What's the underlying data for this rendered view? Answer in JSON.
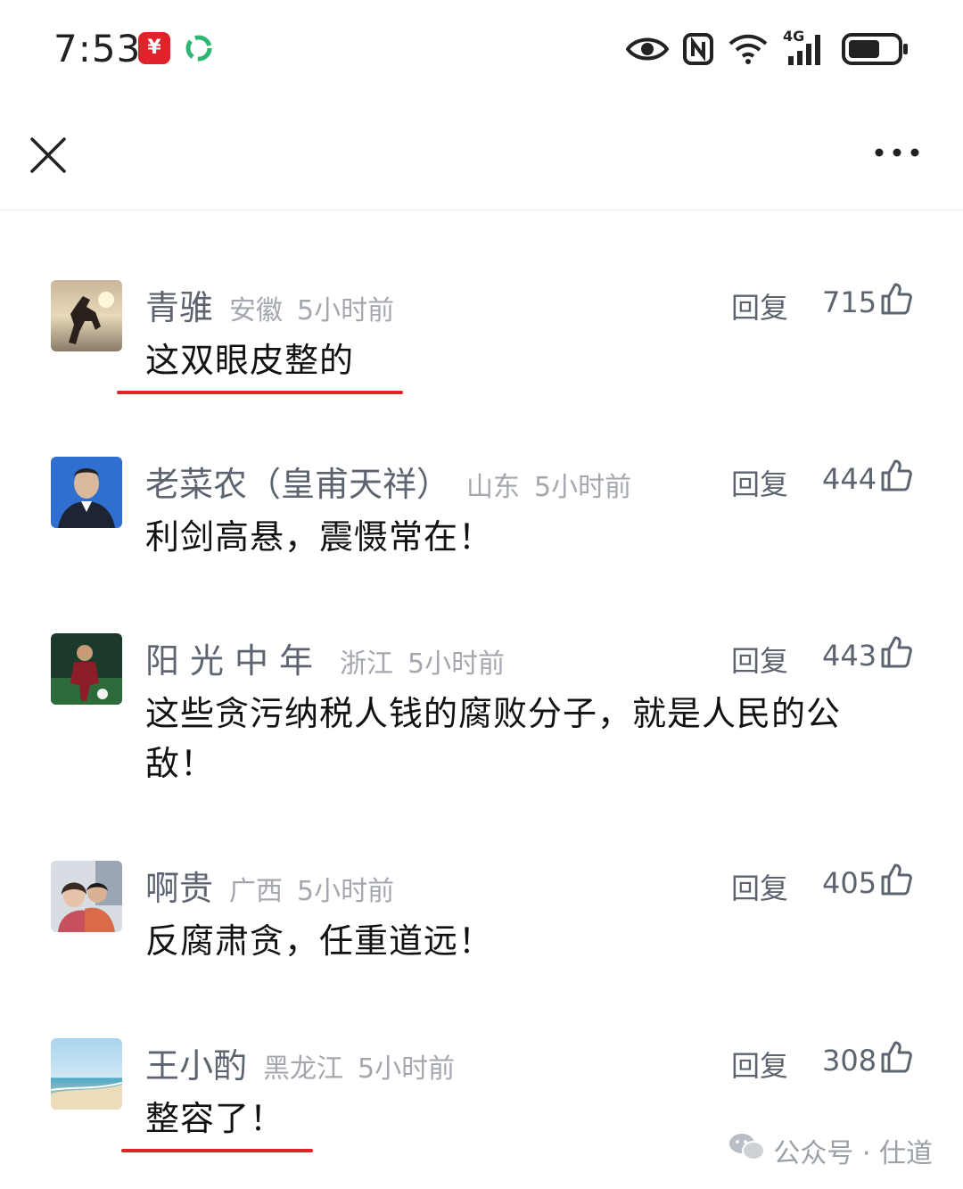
{
  "status_bar": {
    "time": "7:53",
    "app_icon_1": "bank-app-icon",
    "app_icon_2": "green-app-icon",
    "network_label": "4G",
    "icons": [
      "eye-icon",
      "nfc-icon",
      "wifi-icon",
      "cellular-signal-icon",
      "battery-icon"
    ]
  },
  "top_bar": {
    "close_icon": "close-icon",
    "more_icon": "more-icon"
  },
  "comments": [
    {
      "name": "青骓",
      "location": "安徽",
      "time": "5小时前",
      "reply": "回复",
      "likes": "715",
      "text": "这双眼皮整的",
      "underlined": true
    },
    {
      "name": "老菜农（皇甫天祥）",
      "location": "山东",
      "time": "5小时前",
      "reply": "回复",
      "likes": "444",
      "text": "利剑高悬，震慑常在！",
      "underlined": false
    },
    {
      "name": "阳光中年",
      "location": "浙江",
      "time": "5小时前",
      "reply": "回复",
      "likes": "443",
      "text": "这些贪污纳税人钱的腐败分子，就是人民的公敌！",
      "underlined": false
    },
    {
      "name": "啊贵",
      "location": "广西",
      "time": "5小时前",
      "reply": "回复",
      "likes": "405",
      "text": "反腐肃贪，任重道远！",
      "underlined": false
    },
    {
      "name": "王小酌",
      "location": "黑龙江",
      "time": "5小时前",
      "reply": "回复",
      "likes": "308",
      "text": "整容了！",
      "underlined": true
    }
  ],
  "watermark": {
    "icon": "wechat-icon",
    "text": "公众号 · 仕道"
  },
  "colors": {
    "underline": "#e02424",
    "meta_text": "#a4a8ae",
    "name_text": "#5d6470"
  }
}
